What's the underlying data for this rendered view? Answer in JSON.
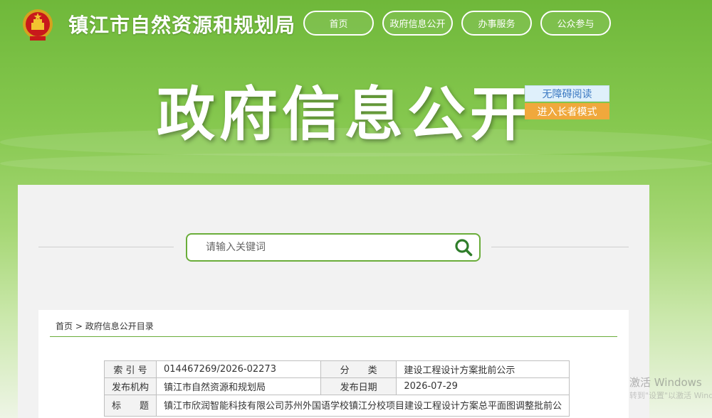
{
  "site": {
    "title": "镇江市自然资源和规划局"
  },
  "nav": [
    {
      "label": "首页"
    },
    {
      "label": "政府信息公开"
    },
    {
      "label": "办事服务"
    },
    {
      "label": "公众参与"
    }
  ],
  "banner": {
    "title": "政府信息公开"
  },
  "accessibility": {
    "barrier_free": "无障碍阅读",
    "elder_mode": "进入长者模式"
  },
  "search": {
    "placeholder": "请输入关键词"
  },
  "breadcrumb": {
    "home": "首页",
    "sep": ">",
    "current": "政府信息公开目录"
  },
  "meta": {
    "index_no_label": "索 引 号",
    "index_no": "014467269/2026-02273",
    "category_label": "分　　类",
    "category": "建设工程设计方案批前公示",
    "publisher_label": "发布机构",
    "publisher": "镇江市自然资源和规划局",
    "date_label": "发布日期",
    "date": "2026-07-29",
    "title_label": "标　　题",
    "title": "镇江市欣润智能科技有限公司苏州外国语学校镇江分校项目建设工程设计方案总平面图调整批前公"
  },
  "watermark": {
    "line1": "激活 Windows",
    "line2": "转到\"设置\"以激活 Windows。"
  },
  "colors": {
    "accent_green": "#6aad3a",
    "elder_orange": "#f0a83c",
    "barrier_blue": "#3a78c2"
  }
}
